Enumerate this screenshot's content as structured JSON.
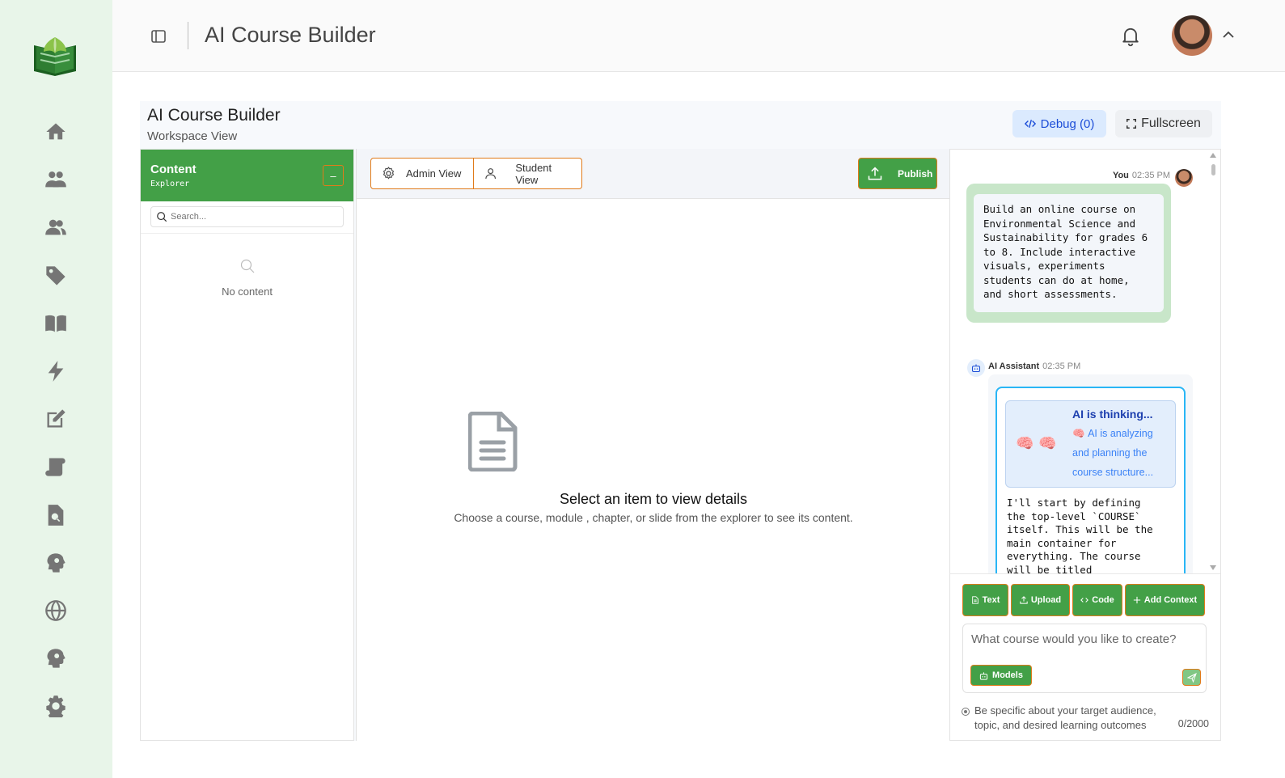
{
  "header": {
    "title": "AI Course Builder"
  },
  "sidebar": {
    "items": [
      {
        "icon": "home-icon"
      },
      {
        "icon": "users-icon"
      },
      {
        "icon": "groups-icon"
      },
      {
        "icon": "tag-icon"
      },
      {
        "icon": "book-icon"
      },
      {
        "icon": "bolt-icon"
      },
      {
        "icon": "edit-icon"
      },
      {
        "icon": "scroll-icon"
      },
      {
        "icon": "file-search-icon"
      },
      {
        "icon": "head-gear-icon"
      },
      {
        "icon": "globe-icon"
      },
      {
        "icon": "head-gear-icon"
      },
      {
        "icon": "settings-icon"
      }
    ]
  },
  "workspace": {
    "title": "AI Course Builder",
    "subtitle": "Workspace View",
    "debug_label": "Debug (0)",
    "fullscreen_label": "Fullscreen"
  },
  "explorer": {
    "title": "Content",
    "subtitle": "Explorer",
    "collapse_label": "–",
    "search_placeholder": "Search...",
    "empty_text": "No content"
  },
  "center": {
    "admin_view_label": "Admin View",
    "student_view_label": "Student View",
    "publish_label": "Publish",
    "empty_title": "Select an item to view details",
    "empty_desc": "Choose a course, module , chapter, or slide from the explorer to see its content."
  },
  "chat": {
    "user_name": "You",
    "user_time": "02:35 PM",
    "user_message": "Build an online course on\nEnvironmental Science and\nSustainability for grades 6\nto 8. Include interactive\nvisuals, experiments\nstudents can do at home,\nand short assessments.",
    "bot_name": "AI Assistant",
    "bot_time": "02:35 PM",
    "thinking_title": "AI is thinking...",
    "thinking_emoji": "🧠",
    "thinking_text": "AI is analyzing and planning the course structure...",
    "bot_message": "I'll start by defining\nthe top-level `COURSE`\nitself. This will be the\nmain container for\neverything. The course\nwill be titled",
    "tools": {
      "text": "Text",
      "upload": "Upload",
      "code": "Code",
      "add_context": "Add Context"
    },
    "input_placeholder": "What course would you like to create?",
    "models_label": "Models",
    "hint": "Be specific about your target audience, topic, and desired learning outcomes",
    "counter": "0/2000"
  },
  "colors": {
    "brand_green": "#43a047",
    "sidebar_bg": "#e8f5e9",
    "accent_orange": "#e07b1a",
    "debug_blue": "#1d4ed8"
  }
}
